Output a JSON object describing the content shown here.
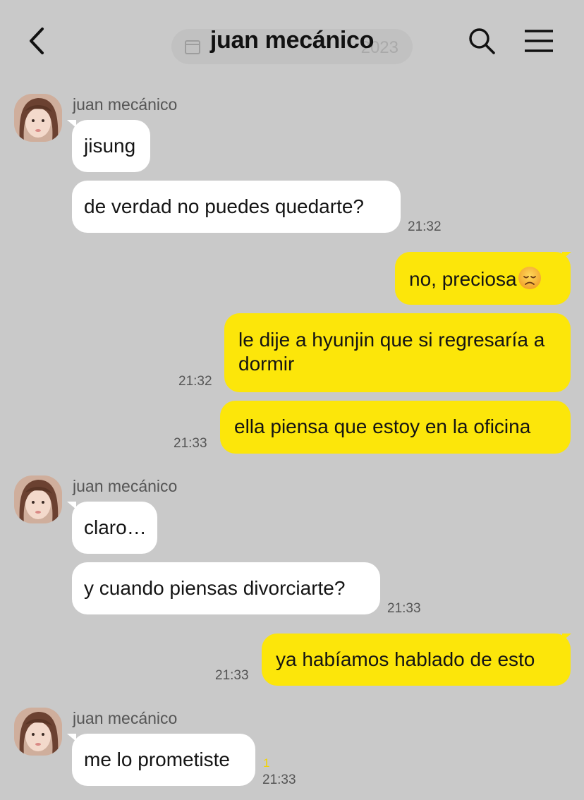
{
  "header": {
    "title": "juan mecánico",
    "date_pill": "2023",
    "icons": {
      "back": "chevron-left-icon",
      "search": "search-icon",
      "menu": "hamburger-menu-icon",
      "calendar": "calendar-icon"
    }
  },
  "colors": {
    "background": "#c9c9c9",
    "incoming_bubble": "#ffffff",
    "outgoing_bubble": "#fce60a",
    "unread": "#f2d300"
  },
  "messages": [
    {
      "direction": "in",
      "sender": "juan mecánico",
      "text": "jisung"
    },
    {
      "direction": "in",
      "text": "de verdad no puedes quedarte?",
      "time": "21:32"
    },
    {
      "direction": "out",
      "text": "no, preciosa",
      "emoji": "disappointed-face"
    },
    {
      "direction": "out",
      "text": "le dije a hyunjin que si regresaría a dormir",
      "time": "21:32"
    },
    {
      "direction": "out",
      "text": "ella piensa que estoy en la oficina",
      "time": "21:33"
    },
    {
      "direction": "in",
      "sender": "juan mecánico",
      "text": "claro…"
    },
    {
      "direction": "in",
      "text": "y cuando piensas divorciarte?",
      "time": "21:33"
    },
    {
      "direction": "out",
      "text": "ya habíamos hablado de esto",
      "time": "21:33"
    },
    {
      "direction": "in",
      "sender": "juan mecánico",
      "text": "me lo prometiste",
      "time": "21:33",
      "unread": "1"
    }
  ]
}
